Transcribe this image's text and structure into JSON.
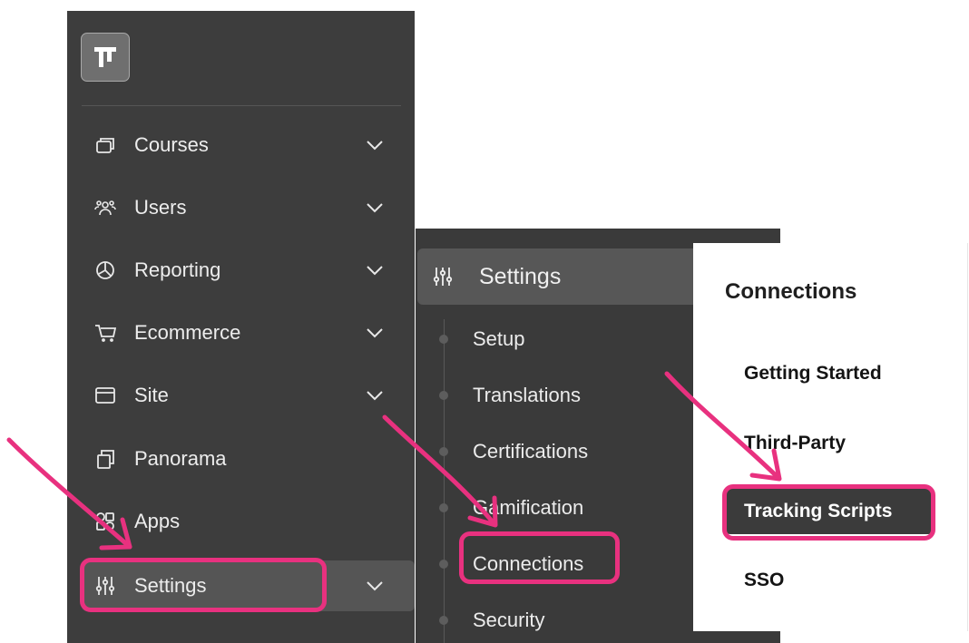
{
  "sidebar": {
    "logo_glyph": "T",
    "items": [
      {
        "label": "Courses",
        "icon": "courses-icon",
        "has_chevron": true
      },
      {
        "label": "Users",
        "icon": "users-icon",
        "has_chevron": true
      },
      {
        "label": "Reporting",
        "icon": "reporting-icon",
        "has_chevron": true
      },
      {
        "label": "Ecommerce",
        "icon": "cart-icon",
        "has_chevron": true
      },
      {
        "label": "Site",
        "icon": "site-icon",
        "has_chevron": true
      },
      {
        "label": "Panorama",
        "icon": "panorama-icon",
        "has_chevron": false
      },
      {
        "label": "Apps",
        "icon": "apps-icon",
        "has_chevron": false
      },
      {
        "label": "Settings",
        "icon": "sliders-icon",
        "has_chevron": true,
        "active": true
      }
    ]
  },
  "settings_menu": {
    "title": "Settings",
    "icon": "sliders-icon",
    "items": [
      {
        "label": "Setup"
      },
      {
        "label": "Translations"
      },
      {
        "label": "Certifications"
      },
      {
        "label": "Gamification"
      },
      {
        "label": "Connections",
        "highlighted": true
      },
      {
        "label": "Security"
      }
    ]
  },
  "connections_menu": {
    "title": "Connections",
    "items": [
      {
        "label": "Getting Started"
      },
      {
        "label": "Third-Party"
      },
      {
        "label": "Tracking Scripts",
        "active": true,
        "highlighted": true
      },
      {
        "label": "SSO"
      }
    ]
  },
  "colors": {
    "sidebar_bg": "#3d3d3d",
    "submenu_bg": "#3a3a3a",
    "active_bg": "#555555",
    "highlight": "#e8317f",
    "text_light": "#ededed",
    "text_dark": "#141414"
  }
}
